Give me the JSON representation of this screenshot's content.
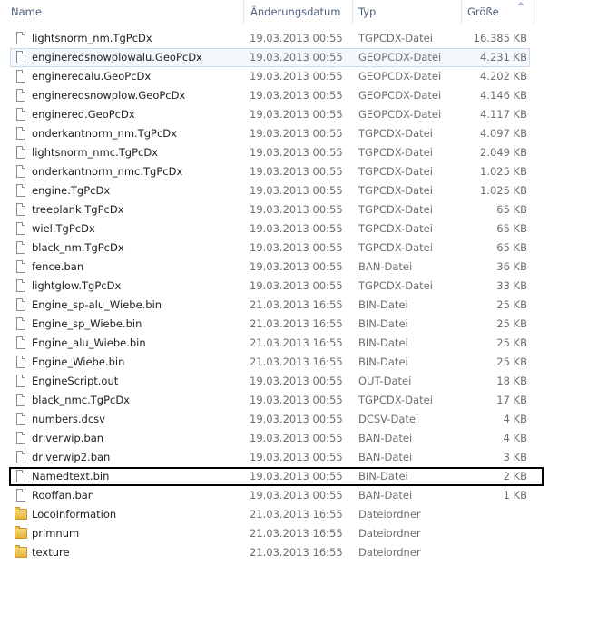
{
  "columns": {
    "name": "Name",
    "date": "Änderungsdatum",
    "type": "Typ",
    "size": "Größe"
  },
  "files": [
    {
      "name": "lightsnorm_nm.TgPcDx",
      "date": "19.03.2013 00:55",
      "type": "TGPCDX-Datei",
      "size": "16.385 KB",
      "icon": "file-icon"
    },
    {
      "name": "engineredsnowplowalu.GeoPcDx",
      "date": "19.03.2013 00:55",
      "type": "GEOPCDX-Datei",
      "size": "4.231 KB",
      "icon": "file-icon",
      "state": "hover"
    },
    {
      "name": "engineredalu.GeoPcDx",
      "date": "19.03.2013 00:55",
      "type": "GEOPCDX-Datei",
      "size": "4.202 KB",
      "icon": "file-icon"
    },
    {
      "name": "engineredsnowplow.GeoPcDx",
      "date": "19.03.2013 00:55",
      "type": "GEOPCDX-Datei",
      "size": "4.146 KB",
      "icon": "file-icon"
    },
    {
      "name": "enginered.GeoPcDx",
      "date": "19.03.2013 00:55",
      "type": "GEOPCDX-Datei",
      "size": "4.117 KB",
      "icon": "file-icon"
    },
    {
      "name": "onderkantnorm_nm.TgPcDx",
      "date": "19.03.2013 00:55",
      "type": "TGPCDX-Datei",
      "size": "4.097 KB",
      "icon": "file-icon"
    },
    {
      "name": "lightsnorm_nmc.TgPcDx",
      "date": "19.03.2013 00:55",
      "type": "TGPCDX-Datei",
      "size": "2.049 KB",
      "icon": "file-icon"
    },
    {
      "name": "onderkantnorm_nmc.TgPcDx",
      "date": "19.03.2013 00:55",
      "type": "TGPCDX-Datei",
      "size": "1.025 KB",
      "icon": "file-icon"
    },
    {
      "name": "engine.TgPcDx",
      "date": "19.03.2013 00:55",
      "type": "TGPCDX-Datei",
      "size": "1.025 KB",
      "icon": "file-icon"
    },
    {
      "name": "treeplank.TgPcDx",
      "date": "19.03.2013 00:55",
      "type": "TGPCDX-Datei",
      "size": "65 KB",
      "icon": "file-icon"
    },
    {
      "name": "wiel.TgPcDx",
      "date": "19.03.2013 00:55",
      "type": "TGPCDX-Datei",
      "size": "65 KB",
      "icon": "file-icon"
    },
    {
      "name": "black_nm.TgPcDx",
      "date": "19.03.2013 00:55",
      "type": "TGPCDX-Datei",
      "size": "65 KB",
      "icon": "file-icon"
    },
    {
      "name": "fence.ban",
      "date": "19.03.2013 00:55",
      "type": "BAN-Datei",
      "size": "36 KB",
      "icon": "file-icon"
    },
    {
      "name": "lightglow.TgPcDx",
      "date": "19.03.2013 00:55",
      "type": "TGPCDX-Datei",
      "size": "33 KB",
      "icon": "file-icon"
    },
    {
      "name": "Engine_sp-alu_Wiebe.bin",
      "date": "21.03.2013 16:55",
      "type": "BIN-Datei",
      "size": "25 KB",
      "icon": "file-icon"
    },
    {
      "name": "Engine_sp_Wiebe.bin",
      "date": "21.03.2013 16:55",
      "type": "BIN-Datei",
      "size": "25 KB",
      "icon": "file-icon"
    },
    {
      "name": "Engine_alu_Wiebe.bin",
      "date": "21.03.2013 16:55",
      "type": "BIN-Datei",
      "size": "25 KB",
      "icon": "file-icon"
    },
    {
      "name": "Engine_Wiebe.bin",
      "date": "21.03.2013 16:55",
      "type": "BIN-Datei",
      "size": "25 KB",
      "icon": "file-icon"
    },
    {
      "name": "EngineScript.out",
      "date": "19.03.2013 00:55",
      "type": "OUT-Datei",
      "size": "18 KB",
      "icon": "file-icon"
    },
    {
      "name": "black_nmc.TgPcDx",
      "date": "19.03.2013 00:55",
      "type": "TGPCDX-Datei",
      "size": "17 KB",
      "icon": "file-icon"
    },
    {
      "name": "numbers.dcsv",
      "date": "19.03.2013 00:55",
      "type": "DCSV-Datei",
      "size": "4 KB",
      "icon": "file-icon"
    },
    {
      "name": "driverwip.ban",
      "date": "19.03.2013 00:55",
      "type": "BAN-Datei",
      "size": "4 KB",
      "icon": "file-icon"
    },
    {
      "name": "driverwip2.ban",
      "date": "19.03.2013 00:55",
      "type": "BAN-Datei",
      "size": "3 KB",
      "icon": "file-icon"
    },
    {
      "name": "Namedtext.bin",
      "date": "19.03.2013 00:55",
      "type": "BIN-Datei",
      "size": "2 KB",
      "icon": "file-icon",
      "state": "boxed"
    },
    {
      "name": "Rooffan.ban",
      "date": "19.03.2013 00:55",
      "type": "BAN-Datei",
      "size": "1 KB",
      "icon": "file-icon"
    },
    {
      "name": "LocoInformation",
      "date": "21.03.2013 16:55",
      "type": "Dateiordner",
      "size": "",
      "icon": "folder-icon"
    },
    {
      "name": "primnum",
      "date": "21.03.2013 16:55",
      "type": "Dateiordner",
      "size": "",
      "icon": "folder-icon"
    },
    {
      "name": "texture",
      "date": "21.03.2013 16:55",
      "type": "Dateiordner",
      "size": "",
      "icon": "folder-icon"
    }
  ]
}
